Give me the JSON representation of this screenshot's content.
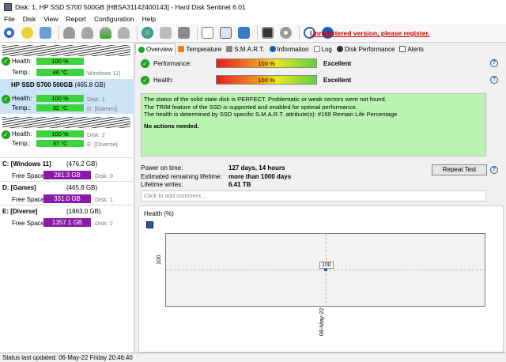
{
  "window": {
    "title": "Disk: 1, HP SSD S700 500GB [HBSA31142400143]  -  Hard Disk Sentinel 6.01"
  },
  "menu": [
    "File",
    "Disk",
    "View",
    "Report",
    "Configuration",
    "Help"
  ],
  "toolbar": {
    "register_link": "Unregistered version, please register.",
    "icons": [
      "refresh-icon",
      "disk-alert-icon",
      "mail-icon",
      "disk-test-icon",
      "disk-config-icon",
      "disk-check-icon",
      "disk-info-icon",
      "globe-icon",
      "printer-icon",
      "drive-icon",
      "document-icon",
      "copy-icon",
      "network-icon",
      "monitor-icon",
      "cd-icon",
      "help-icon",
      "info-icon"
    ]
  },
  "left": {
    "disk1": {
      "health_label": "Health:",
      "temp_label": "Temp.:",
      "health": "100 %",
      "temp": "46 °C",
      "right": "Windows 11]"
    },
    "disk2": {
      "title": "HP SSD S700 500GB",
      "size": "(465.8 GB)",
      "health_label": "Health:",
      "temp_label": "Temp.:",
      "health": "100 %",
      "temp": "32 °C",
      "right1": "Disk: 1",
      "right2": "D: [Games]"
    },
    "disk3": {
      "health_label": "Health:",
      "temp_label": "Temp.:",
      "health": "100 %",
      "temp": "37 °C",
      "right1": "Disk: 2",
      "right2": "E: [Diverse]"
    },
    "volumes": [
      {
        "title": "C: [Windows 11]",
        "size": "(476.2 GB)",
        "fs_label": "Free Space",
        "free": "281.3 GB",
        "disk": "Disk: 0"
      },
      {
        "title": "D: [Games]",
        "size": "(465.8 GB)",
        "fs_label": "Free Space",
        "free": "331.0 GB",
        "disk": "Disk: 1"
      },
      {
        "title": "E: [Diverse]",
        "size": "(1863.0 GB)",
        "fs_label": "Free Space",
        "free": "1357.1 GB",
        "disk": "Disk: 2"
      }
    ]
  },
  "tabs": [
    "Overview",
    "Temperature",
    "S.M.A.R.T.",
    "Information",
    "Log",
    "Disk Performance",
    "Alerts"
  ],
  "overview": {
    "performance_label": "Performance:",
    "performance_value": "100 %",
    "performance_result": "Excellent",
    "health_label": "Health:",
    "health_value": "100 %",
    "health_result": "Excellent",
    "status_lines": [
      "The status of the solid state disk is PERFECT. Problematic or weak sectors were not found.",
      "The TRIM feature of the SSD is supported and enabled for optimal performance.",
      "The health is determined by SSD specific S.M.A.R.T. attribute(s):  #169 Remain Life Percentage"
    ],
    "no_action": "No actions needed.",
    "power_on_label": "Power on time:",
    "power_on_value": "127 days, 14 hours",
    "remaining_label": "Estimated remaining lifetime:",
    "remaining_value": "more than 1000 days",
    "writes_label": "Lifetime writes:",
    "writes_value": "6.41 TB",
    "repeat_test": "Repeat Test",
    "comment_placeholder": "Click to add comment ...",
    "help_glyph": "?"
  },
  "chart_data": {
    "type": "line",
    "title": "Health (%)",
    "x": [
      "06-May-22"
    ],
    "series": [
      {
        "values": [
          100
        ]
      }
    ],
    "ylabel": "",
    "xlabel": "",
    "ytick": "100",
    "point_label": "100"
  },
  "statusbar": {
    "text": "Status last updated: 06-May-22 Friday 20:46:40"
  },
  "colors": {
    "health_bar": "#3cd43c",
    "free_space_bar": "#8a1aa8",
    "status_bg": "#b9f5b0",
    "register_link": "#d00000"
  }
}
